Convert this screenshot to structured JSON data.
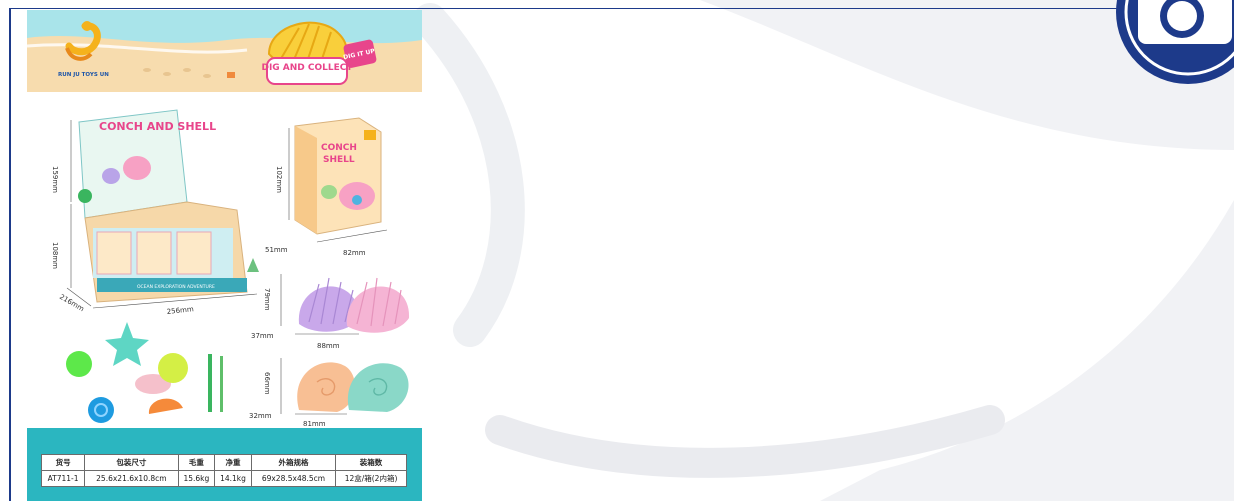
{
  "poster": {
    "logo_text": "RUN JU TOYS UN",
    "headline_main": "DIG AND COLLECT",
    "headline_badge": "DIG IT UP",
    "product_title": "CONCH AND SHELL",
    "display_box_caption": "OCEAN EXPLORATION ADVENTURE"
  },
  "dimensions": {
    "display_height": "159mm",
    "display_box_height": "108mm",
    "display_depth": "216mm",
    "display_width": "256mm",
    "box_height": "102mm",
    "box_depth": "51mm",
    "box_width": "82mm",
    "shell_height_1": "79mm",
    "shell_depth_1": "37mm",
    "shell_width_1": "88mm",
    "shell_height_2": "66mm",
    "shell_depth_2": "32mm",
    "shell_width_2": "81mm"
  },
  "spec_table": {
    "headers": [
      "货号",
      "包装尺寸",
      "毛重",
      "净重",
      "外箱规格",
      "装箱数"
    ],
    "row": [
      "AT711-1",
      "25.6x21.6x10.8cm",
      "15.6kg",
      "14.1kg",
      "69x28.5x48.5cm",
      "12盒/箱(2内箱)"
    ]
  },
  "colors": {
    "frame": "#1d3a8a",
    "sky": "#a9e4ea",
    "sand": "#f7dcae",
    "table_band": "#2bb6c0"
  },
  "icons": {
    "corner_badge": "camera-icon"
  }
}
